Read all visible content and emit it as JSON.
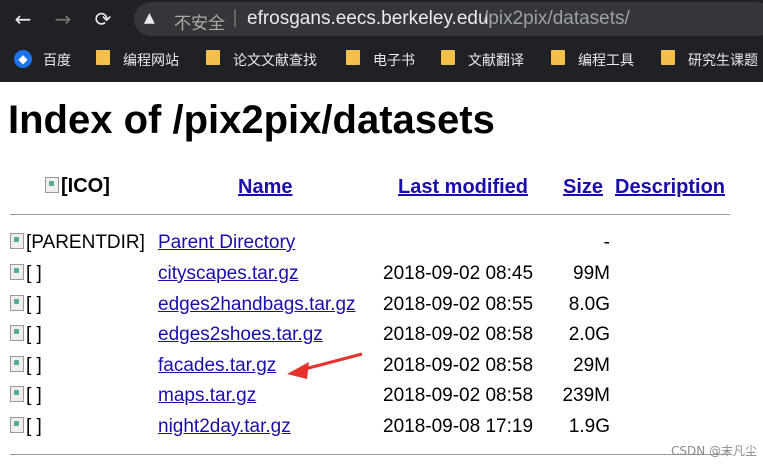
{
  "browser": {
    "nav_back": "←",
    "nav_forward": "→",
    "nav_reload": "⟳",
    "address": {
      "security_icon": "warning-triangle-icon",
      "security_label": "不安全",
      "separator": "|",
      "host": "efrosgans.eecs.berkeley.edu",
      "path": "/pix2pix/datasets/"
    },
    "bookmarks": [
      {
        "label": "百度",
        "icon": "globe-icon"
      },
      {
        "label": "编程网站",
        "icon": "folder-icon"
      },
      {
        "label": "论文文献查找",
        "icon": "folder-icon"
      },
      {
        "label": "电子书",
        "icon": "folder-icon"
      },
      {
        "label": "文献翻译",
        "icon": "folder-icon"
      },
      {
        "label": "编程工具",
        "icon": "folder-icon"
      },
      {
        "label": "研究生课题",
        "icon": "folder-icon"
      }
    ]
  },
  "page": {
    "title": "Index of /pix2pix/datasets",
    "headers": {
      "icon": "[ICO]",
      "name": "Name",
      "last_modified": "Last modified",
      "size": "Size",
      "description": "Description"
    },
    "parent": {
      "icon_alt": "[PARENTDIR]",
      "name": "Parent Directory",
      "size": "-"
    },
    "rows": [
      {
        "icon_alt": "[ ]",
        "name": "cityscapes.tar.gz",
        "modified": "2018-09-02 08:45",
        "size": "99M"
      },
      {
        "icon_alt": "[ ]",
        "name": "edges2handbags.tar.gz",
        "modified": "2018-09-02 08:55",
        "size": "8.0G"
      },
      {
        "icon_alt": "[ ]",
        "name": "edges2shoes.tar.gz",
        "modified": "2018-09-02 08:58",
        "size": "2.0G"
      },
      {
        "icon_alt": "[ ]",
        "name": "facades.tar.gz",
        "modified": "2018-09-02 08:58",
        "size": "29M"
      },
      {
        "icon_alt": "[ ]",
        "name": "maps.tar.gz",
        "modified": "2018-09-02 08:58",
        "size": "239M"
      },
      {
        "icon_alt": "[ ]",
        "name": "night2day.tar.gz",
        "modified": "2018-09-08 17:19",
        "size": "1.9G"
      }
    ]
  },
  "annotation": {
    "arrow_color": "#e5322d"
  },
  "watermark": "CSDN @末凡尘",
  "colors": {
    "chrome_bg": "#202124",
    "link": "#1a0dab"
  }
}
